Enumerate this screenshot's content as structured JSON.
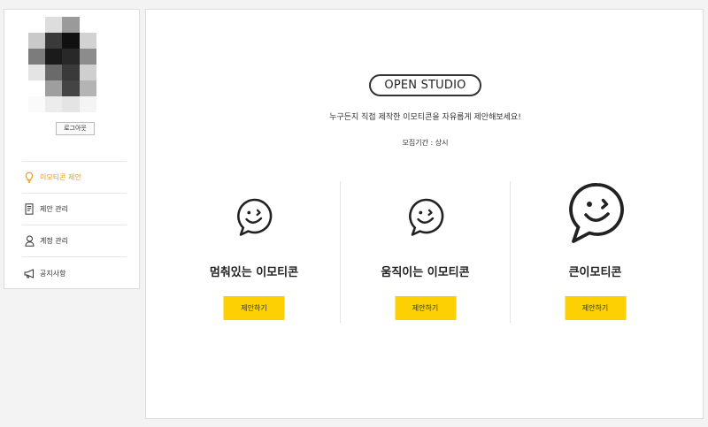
{
  "sidebar": {
    "logout_label": "로그아웃",
    "menu": [
      {
        "label": "이모티콘 제안",
        "icon": "lightbulb-icon",
        "active": true
      },
      {
        "label": "제안 관리",
        "icon": "document-icon",
        "active": false
      },
      {
        "label": "계정 관리",
        "icon": "user-icon",
        "active": false
      },
      {
        "label": "공지사항",
        "icon": "megaphone-icon",
        "active": false
      }
    ]
  },
  "main": {
    "badge": "OPEN STUDIO",
    "intro": "누구든지 직접 제작한 이모티콘을 자유롭게 제안해보세요!",
    "period": "모집기간 : 상시",
    "types": [
      {
        "title": "멈춰있는 이모티콘",
        "button": "제안하기",
        "icon": "speech-bubble-smile-icon"
      },
      {
        "title": "움직이는 이모티콘",
        "button": "제안하기",
        "icon": "speech-bubble-smile-icon"
      },
      {
        "title": "큰이모티콘",
        "button": "제안하기",
        "icon": "large-speech-bubble-smile-icon"
      }
    ]
  },
  "colors": {
    "accent": "#fcd003",
    "active_menu": "#e19a12",
    "border": "#dddddd"
  }
}
